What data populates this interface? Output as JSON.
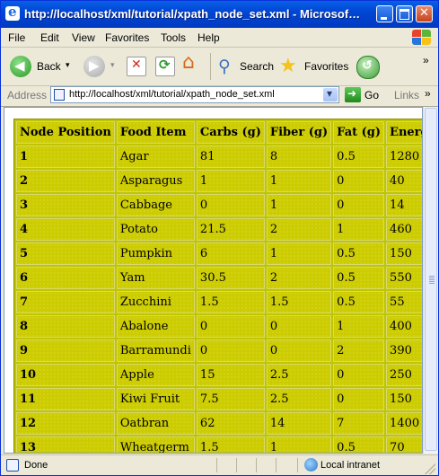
{
  "window": {
    "title": "http://localhost/xml/tutorial/xpath_node_set.xml - Microsof…"
  },
  "menu": {
    "items": [
      "File",
      "Edit",
      "View",
      "Favorites",
      "Tools",
      "Help"
    ]
  },
  "toolbar": {
    "back_label": "Back",
    "search_label": "Search",
    "favorites_label": "Favorites"
  },
  "address": {
    "label": "Address",
    "url": "http://localhost/xml/tutorial/xpath_node_set.xml",
    "go_label": "Go",
    "links_label": "Links"
  },
  "table": {
    "headers": [
      "Node Position",
      "Food Item",
      "Carbs (g)",
      "Fiber (g)",
      "Fat (g)",
      "Energy (kj)"
    ],
    "rows": [
      [
        "1",
        "Agar",
        "81",
        "8",
        "0.5",
        "1280"
      ],
      [
        "2",
        "Asparagus",
        "1",
        "1",
        "0",
        "40"
      ],
      [
        "3",
        "Cabbage",
        "0",
        "1",
        "0",
        "14"
      ],
      [
        "4",
        "Potato",
        "21.5",
        "2",
        "1",
        "460"
      ],
      [
        "5",
        "Pumpkin",
        "6",
        "1",
        "0.5",
        "150"
      ],
      [
        "6",
        "Yam",
        "30.5",
        "2",
        "0.5",
        "550"
      ],
      [
        "7",
        "Zucchini",
        "1.5",
        "1.5",
        "0.5",
        "55"
      ],
      [
        "8",
        "Abalone",
        "0",
        "0",
        "1",
        "400"
      ],
      [
        "9",
        "Barramundi",
        "0",
        "0",
        "2",
        "390"
      ],
      [
        "10",
        "Apple",
        "15",
        "2.5",
        "0",
        "250"
      ],
      [
        "11",
        "Kiwi Fruit",
        "7.5",
        "2.5",
        "0",
        "150"
      ],
      [
        "12",
        "Oatbran",
        "62",
        "14",
        "7",
        "1400"
      ],
      [
        "13",
        "Wheatgerm",
        "1.5",
        "1",
        "0.5",
        "70"
      ]
    ]
  },
  "status": {
    "text": "Done",
    "zone": "Local intranet"
  },
  "colors": {
    "title_bar": "#0046d5",
    "chrome": "#ece9d8",
    "table_cell": "#cccc00"
  }
}
